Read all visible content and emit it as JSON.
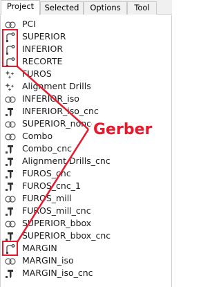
{
  "tabs": [
    {
      "label": "Project",
      "active": true
    },
    {
      "label": "Selected",
      "active": false
    },
    {
      "label": "Options",
      "active": false
    },
    {
      "label": "Tool",
      "active": false
    }
  ],
  "rows": [
    {
      "label": "PCI",
      "icon": "geometry-icon"
    },
    {
      "label": "SUPERIOR",
      "icon": "gerber-icon"
    },
    {
      "label": "INFERIOR",
      "icon": "gerber-icon"
    },
    {
      "label": "RECORTE",
      "icon": "gerber-icon"
    },
    {
      "label": "FUROS",
      "icon": "excellon-icon"
    },
    {
      "label": "Alignment Drills",
      "icon": "excellon-icon"
    },
    {
      "label": "INFERIOR_iso",
      "icon": "geometry-icon"
    },
    {
      "label": "INFERIOR_iso_cnc",
      "icon": "cnc-job-icon"
    },
    {
      "label": "SUPERIOR_noncopper",
      "icon": "geometry-icon"
    },
    {
      "label": "Combo",
      "icon": "geometry-icon"
    },
    {
      "label": "Combo_cnc",
      "icon": "cnc-job-icon"
    },
    {
      "label": "Alignment Drills_cnc",
      "icon": "cnc-job-icon"
    },
    {
      "label": "FUROS_cnc",
      "icon": "cnc-job-icon"
    },
    {
      "label": "FUROS_cnc_1",
      "icon": "cnc-job-icon"
    },
    {
      "label": "FUROS_mill",
      "icon": "geometry-icon"
    },
    {
      "label": "FUROS_mill_cnc",
      "icon": "cnc-job-icon"
    },
    {
      "label": "SUPERIOR_bbox",
      "icon": "geometry-icon"
    },
    {
      "label": "SUPERIOR_bbox_cnc",
      "icon": "cnc-job-icon"
    },
    {
      "label": "MARGIN",
      "icon": "gerber-icon"
    },
    {
      "label": "MARGIN_iso",
      "icon": "geometry-icon"
    },
    {
      "label": "MARGIN_iso_cnc",
      "icon": "cnc-job-icon"
    }
  ],
  "annotation": {
    "label": "Gerber",
    "color": "#e8192c"
  }
}
